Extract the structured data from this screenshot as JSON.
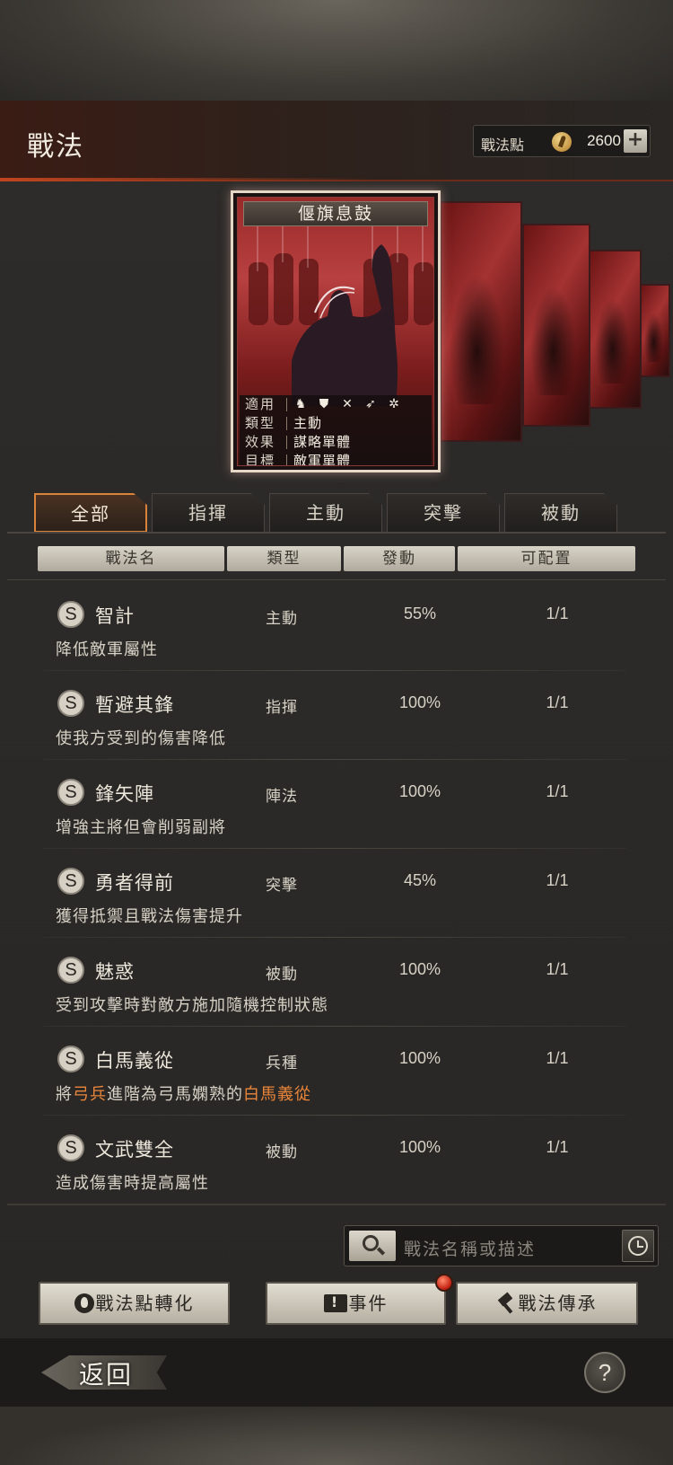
{
  "header": {
    "title": "戰法",
    "points_label": "戰法點",
    "points_value": "2600",
    "plus_label": "+"
  },
  "featured_card": {
    "name": "偃旗息鼓",
    "rows": [
      {
        "key": "適用",
        "value": ""
      },
      {
        "key": "類型",
        "value": "主動"
      },
      {
        "key": "效果",
        "value": "謀略單體"
      },
      {
        "key": "目標",
        "value": "敵軍單體"
      }
    ],
    "unit_icons": [
      "cavalry-icon",
      "shield-icon",
      "crossed-bow-icon",
      "spear-icon",
      "wheel-icon"
    ]
  },
  "tabs": [
    {
      "label": "全部",
      "active": true
    },
    {
      "label": "指揮",
      "active": false
    },
    {
      "label": "主動",
      "active": false
    },
    {
      "label": "突擊",
      "active": false
    },
    {
      "label": "被動",
      "active": false
    }
  ],
  "columns": [
    "戰法名",
    "類型",
    "發動",
    "可配置"
  ],
  "rows": [
    {
      "grade": "S",
      "name": "智計",
      "type": "主動",
      "rate": "55%",
      "count": "1/1",
      "desc": "降低敵軍屬性"
    },
    {
      "grade": "S",
      "name": "暫避其鋒",
      "type": "指揮",
      "rate": "100%",
      "count": "1/1",
      "desc": "使我方受到的傷害降低"
    },
    {
      "grade": "S",
      "name": "鋒矢陣",
      "type": "陣法",
      "rate": "100%",
      "count": "1/1",
      "desc": "增強主將但會削弱副將"
    },
    {
      "grade": "S",
      "name": "勇者得前",
      "type": "突擊",
      "rate": "45%",
      "count": "1/1",
      "desc": "獲得抵禦且戰法傷害提升"
    },
    {
      "grade": "S",
      "name": "魅惑",
      "type": "被動",
      "rate": "100%",
      "count": "1/1",
      "desc": "受到攻擊時對敵方施加隨機控制狀態"
    },
    {
      "grade": "S",
      "name": "白馬義從",
      "type": "兵種",
      "rate": "100%",
      "count": "1/1",
      "desc_parts": [
        "將",
        "弓兵",
        "進階為弓馬嫻熟的",
        "白馬義從"
      ]
    },
    {
      "grade": "S",
      "name": "文武雙全",
      "type": "被動",
      "rate": "100%",
      "count": "1/1",
      "desc": "造成傷害時提高屬性"
    }
  ],
  "search": {
    "placeholder": "戰法名稱或描述"
  },
  "actions": {
    "convert_label": "戰法點轉化",
    "event_label": "事件",
    "inherit_label": "戰法傳承"
  },
  "footer": {
    "back_label": "返回",
    "help_label": "?"
  },
  "colors": {
    "accent": "#d8823a",
    "highlight": "#e8853a",
    "card_red": "#a43232"
  }
}
